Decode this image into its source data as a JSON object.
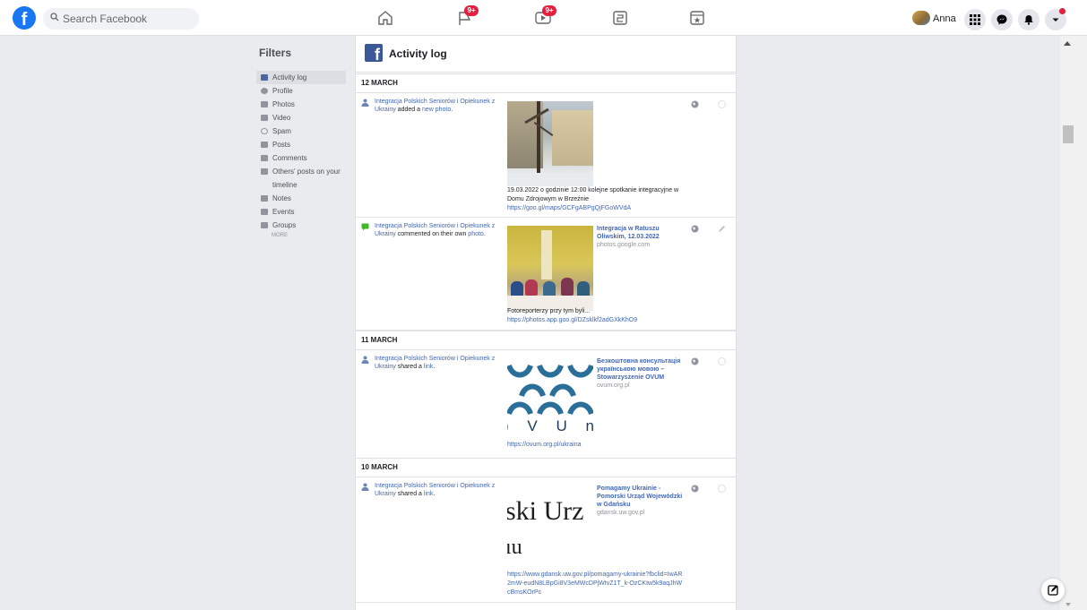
{
  "topbar": {
    "search_placeholder": "Search Facebook",
    "notifications_badge": "9+",
    "watch_badge": "9+",
    "profile_name": "Anna"
  },
  "filters": {
    "title": "Filters",
    "items": [
      {
        "label": "Activity log",
        "icon": "facebook-icon"
      },
      {
        "label": "Profile",
        "icon": "profile-icon"
      },
      {
        "label": "Photos",
        "icon": "photos-icon"
      },
      {
        "label": "Video",
        "icon": "video-icon"
      },
      {
        "label": "Spam",
        "icon": "spam-icon"
      },
      {
        "label": "Posts",
        "icon": "posts-icon"
      },
      {
        "label": "Comments",
        "icon": "comments-icon"
      },
      {
        "label": "Others' posts on your",
        "icon": "others-posts-icon"
      },
      {
        "label": "timeline",
        "icon": ""
      },
      {
        "label": "Notes",
        "icon": "notes-icon"
      },
      {
        "label": "Events",
        "icon": "events-icon"
      },
      {
        "label": "Groups",
        "icon": "groups-icon"
      }
    ],
    "more": "MORE"
  },
  "main": {
    "title": "Activity log",
    "dates": [
      "12 MARCH",
      "11 MARCH",
      "10 MARCH"
    ],
    "entries": [
      {
        "actor": "Integracja Polskich Seniorów i Opiekunek z Ukrainy",
        "action": "added a",
        "object": "new photo",
        "caption": "19.03.2022 o godzinie 12:00 kolejne spotkanie integracyjne w Domu Zdrojowym w Brzeźnie",
        "caption_link": "https://goo.gl/maps/GCFgABPgQjFGoWVdA"
      },
      {
        "actor": "Integracja Polskich Seniorów i Opiekunek z Ukrainy",
        "action": "commented on their own",
        "object": "photo",
        "side_title": "Integracja w Ratuszu Oliwskim, 12.03.2022",
        "side_domain": "photos.google.com",
        "caption": "Fotoreporterzy przy tym byli...",
        "caption_link": "https://photos.app.goo.gl/DZsklkf2adGXkKhO9"
      },
      {
        "actor": "Integracja Polskich Seniorów i Opiekunek z Ukrainy",
        "action": "shared a",
        "object": "link",
        "side_title": "Безкоштовна консультація українською мовою – Stowarzyszenie OVUM",
        "side_domain": "ovum.org.pl",
        "logo_text": ") V U n",
        "caption_link": "https://ovum.org.pl/ukraina"
      },
      {
        "actor": "Integracja Polskich Seniorów i Opiekunek z Ukrainy",
        "action": "shared a",
        "object": "link",
        "side_title": "Pomagamy Ukrainie - Pomorski Urząd Wojewódzki w Gdańsku",
        "side_domain": "gdansk.uw.gov.pl",
        "thumb_line1": "ski Urz",
        "thumb_line2": "ıu",
        "caption_link": "https://www.gdansk.uw.gov.pl/pomagamy-ukrainie?fbclid=IwAR2mW-eudN8LBpGi8V3eMWcDPjWtvZ1T_k-OzCKtw5k9aqJhWcBmsKOrPc"
      }
    ]
  }
}
